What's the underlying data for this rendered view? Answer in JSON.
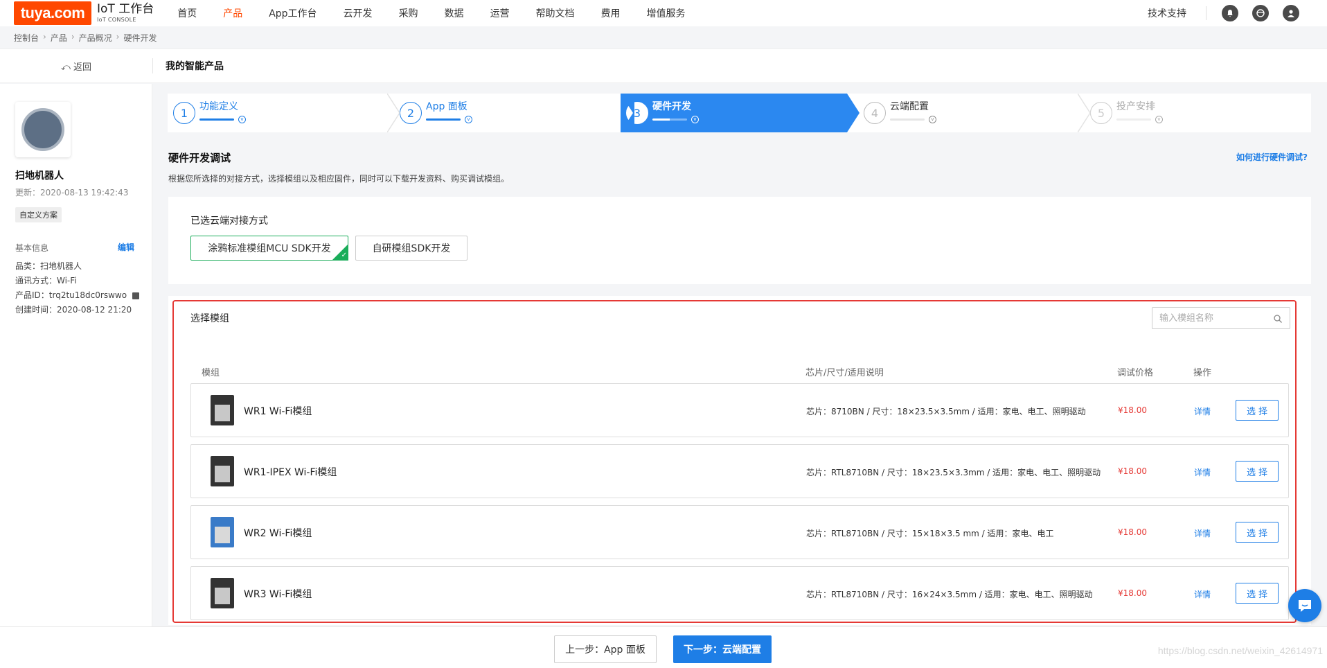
{
  "brand": {
    "logo_text": "tuya.com",
    "title": "IoT 工作台",
    "subtitle": "IoT CONSOLE"
  },
  "nav": {
    "items": [
      {
        "label": "首页"
      },
      {
        "label": "产品"
      },
      {
        "label": "App工作台"
      },
      {
        "label": "云开发"
      },
      {
        "label": "采购"
      },
      {
        "label": "数据"
      },
      {
        "label": "运营"
      },
      {
        "label": "帮助文档"
      },
      {
        "label": "费用"
      },
      {
        "label": "增值服务"
      }
    ],
    "active_index": 1,
    "tech_support": "技术支持"
  },
  "breadcrumb": [
    "控制台",
    "产品",
    "产品概况",
    "硬件开发"
  ],
  "subheader": {
    "back_label": "返回",
    "title": "我的智能产品"
  },
  "product": {
    "name": "扫地机器人",
    "updated": "更新：2020-08-13 19:42:43",
    "tag": "自定义方案",
    "basic_info_label": "基本信息",
    "edit_label": "编辑",
    "category": "品类：扫地机器人",
    "comm": "通讯方式：Wi-Fi",
    "product_id": "产品ID：trq2tu18dc0rswwo",
    "created": "创建时间：2020-08-12 21:20"
  },
  "steps": [
    {
      "num": "1",
      "label": "功能定义"
    },
    {
      "num": "2",
      "label": "App 面板"
    },
    {
      "num": "3",
      "label": "硬件开发"
    },
    {
      "num": "4",
      "label": "云端配置"
    },
    {
      "num": "5",
      "label": "投产安排"
    }
  ],
  "hardware": {
    "title": "硬件开发调试",
    "desc": "根据您所选择的对接方式，选择模组以及相应固件，同时可以下载开发资料、购买调试模组。",
    "help_link": "如何进行硬件调试?"
  },
  "cloud": {
    "title": "已选云端对接方式",
    "options": [
      "涂鸦标准模组MCU SDK开发",
      "自研模组SDK开发"
    ],
    "selected_index": 0
  },
  "modules": {
    "title": "选择模组",
    "search_placeholder": "输入模组名称",
    "headers": {
      "module": "模组",
      "spec": "芯片/尺寸/适用说明",
      "price": "调试价格",
      "action": "操作"
    },
    "rows": [
      {
        "name": "WR1 Wi-Fi模组",
        "spec": "芯片：8710BN / 尺寸：18×23.5×3.5mm / 适用：家电、电工、照明驱动",
        "price": "¥18.00",
        "detail": "详情",
        "select": "选择"
      },
      {
        "name": "WR1-IPEX Wi-Fi模组",
        "spec": "芯片：RTL8710BN / 尺寸：18×23.5×3.3mm / 适用：家电、电工、照明驱动",
        "price": "¥18.00",
        "detail": "详情",
        "select": "选择"
      },
      {
        "name": "WR2 Wi-Fi模组",
        "spec": "芯片：RTL8710BN / 尺寸：15×18×3.5 mm / 适用：家电、电工",
        "price": "¥18.00",
        "detail": "详情",
        "select": "选择"
      },
      {
        "name": "WR3 Wi-Fi模组",
        "spec": "芯片：RTL8710BN / 尺寸：16×24×3.5mm / 适用：家电、电工、照明驱动",
        "price": "¥18.00",
        "detail": "详情",
        "select": "选择"
      }
    ]
  },
  "footer": {
    "prev_label": "上一步：App 面板",
    "next_label": "下一步：云端配置",
    "watermark": "https://blog.csdn.net/weixin_42614971"
  },
  "colors": {
    "brand": "#ff4800",
    "accent": "#1e7ee6",
    "price": "#e53935",
    "selected": "#1aad5a",
    "highlight_frame": "#e53935"
  }
}
